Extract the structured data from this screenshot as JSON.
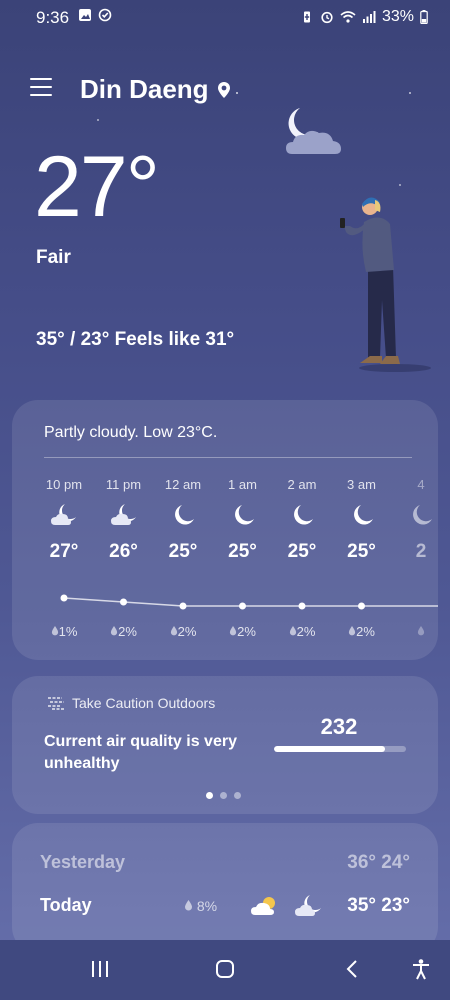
{
  "status_bar": {
    "time": "9:36",
    "battery": "33%",
    "icons": [
      "gallery-icon",
      "check-circle-icon",
      "battery-saver-icon",
      "alarm-icon",
      "wifi-icon",
      "signal-icon",
      "battery-icon"
    ]
  },
  "header": {
    "location": "Din Daeng",
    "location_icon": "pin-icon"
  },
  "current": {
    "temperature": "27°",
    "condition": "Fair",
    "hi_lo_feels": "35° / 23° Feels like 31°"
  },
  "hourly": {
    "summary": "Partly cloudy. Low 23°C.",
    "hours": [
      {
        "time": "10 pm",
        "temp": "27°",
        "precip": "1%",
        "icon": "cloudy-moon-icon",
        "value": 27
      },
      {
        "time": "11 pm",
        "temp": "26°",
        "precip": "2%",
        "icon": "cloudy-moon-icon",
        "value": 26
      },
      {
        "time": "12 am",
        "temp": "25°",
        "precip": "2%",
        "icon": "moon-icon",
        "value": 25
      },
      {
        "time": "1 am",
        "temp": "25°",
        "precip": "2%",
        "icon": "moon-icon",
        "value": 25
      },
      {
        "time": "2 am",
        "temp": "25°",
        "precip": "2%",
        "icon": "moon-icon",
        "value": 25
      },
      {
        "time": "3 am",
        "temp": "25°",
        "precip": "2%",
        "icon": "moon-icon",
        "value": 25
      },
      {
        "time": "4",
        "temp": "2",
        "precip": "",
        "icon": "moon-icon",
        "value": 25
      }
    ]
  },
  "air_quality": {
    "caution": "Take Caution Outdoors",
    "message": "Current air quality is very unhealthy",
    "value": "232",
    "level_fraction": 0.84,
    "pages": 3,
    "active_page": 0
  },
  "daily": {
    "yesterday": {
      "label": "Yesterday",
      "temps": "36° 24°"
    },
    "today": {
      "label": "Today",
      "precip": "8%",
      "temps": "35° 23°"
    }
  },
  "nav": {
    "buttons": [
      "recent-apps-icon",
      "home-icon",
      "back-icon",
      "accessibility-icon"
    ]
  }
}
